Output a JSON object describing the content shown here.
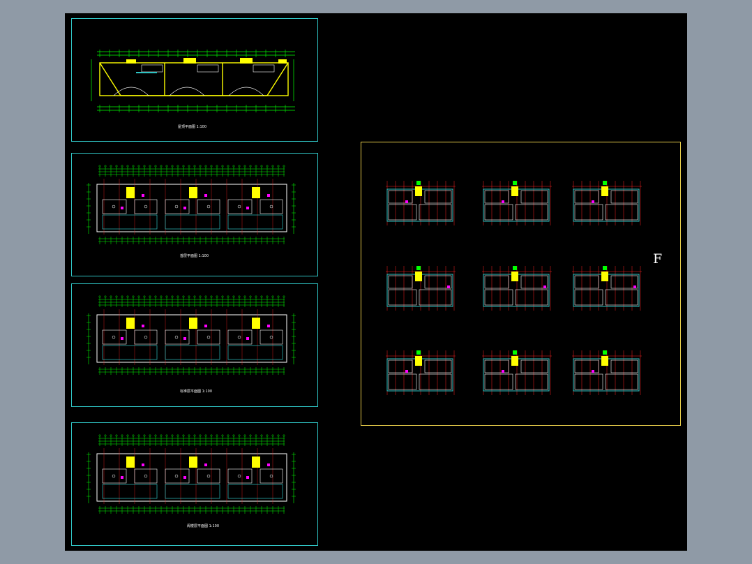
{
  "drawing": {
    "sheets": [
      {
        "title": "屋顶平面图",
        "scale": "1:100"
      },
      {
        "title": "首层平面图",
        "scale": "1:100"
      },
      {
        "title": "标准层平面图",
        "scale": "1:100"
      },
      {
        "title": "阁楼层平面图",
        "scale": "1:100"
      }
    ],
    "unit_set": {
      "letter": "F",
      "rows": 3,
      "cols": 3
    }
  },
  "colors": {
    "model_background": "#000000",
    "app_background": "#8f9aa6",
    "frame_cyan": "#2fc4c4",
    "frame_yellow": "#e6cc4a",
    "axis_green": "#00ff00",
    "wall_white": "#ffffff",
    "dim_red": "#ff2020",
    "door_magenta": "#ff00ff",
    "stair_yellow": "#ffff00"
  }
}
